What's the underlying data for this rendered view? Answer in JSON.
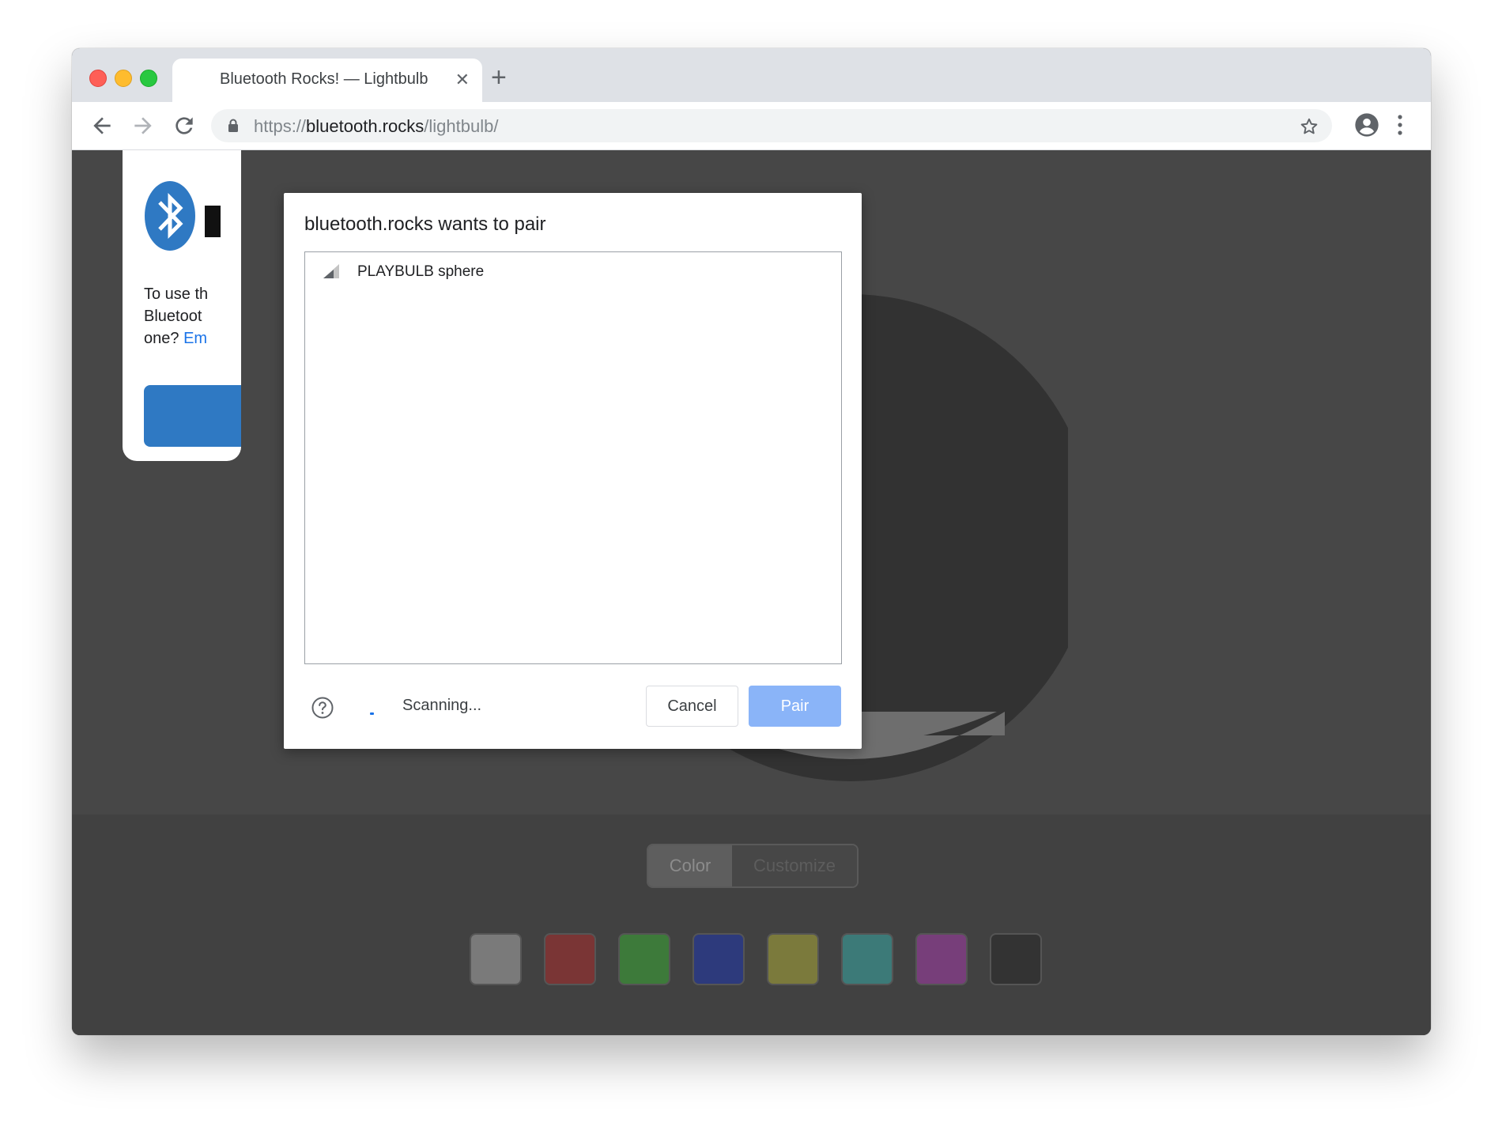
{
  "browser": {
    "tab": {
      "title": "Bluetooth Rocks! — Lightbulb",
      "close_glyph": "✕"
    },
    "new_tab_glyph": "+",
    "url": {
      "scheme": "https://",
      "host": "bluetooth.rocks",
      "path": "/lightbulb/"
    },
    "icons": [
      "back-arrow-icon",
      "forward-arrow-icon",
      "reload-icon",
      "lock-icon",
      "bookmark-star-icon",
      "profile-icon",
      "menu-dots-icon"
    ]
  },
  "page": {
    "card": {
      "text_lines": [
        "To use th",
        "Bluetoot",
        "one? "
      ],
      "link_fragment": "Em"
    },
    "segmented": {
      "color_label": "Color",
      "customize_label": "Customize"
    },
    "swatch_colors": [
      "#7a7a7a",
      "#7a3535",
      "#3d7a3a",
      "#2d3a7c",
      "#7b7a3c",
      "#3c7a78",
      "#773e7a",
      "#333333"
    ]
  },
  "dialog": {
    "title": "bluetooth.rocks wants to pair",
    "devices": [
      {
        "name": "PLAYBULB sphere",
        "icon": "signal-strength-icon"
      }
    ],
    "status": "Scanning...",
    "cancel_label": "Cancel",
    "pair_label": "Pair"
  },
  "colors": {
    "accent": "#1a73e8",
    "pair_button_disabled": "#8ab4f8",
    "bluetooth_brand": "#2f79c3",
    "page_overlay": "#474747"
  }
}
